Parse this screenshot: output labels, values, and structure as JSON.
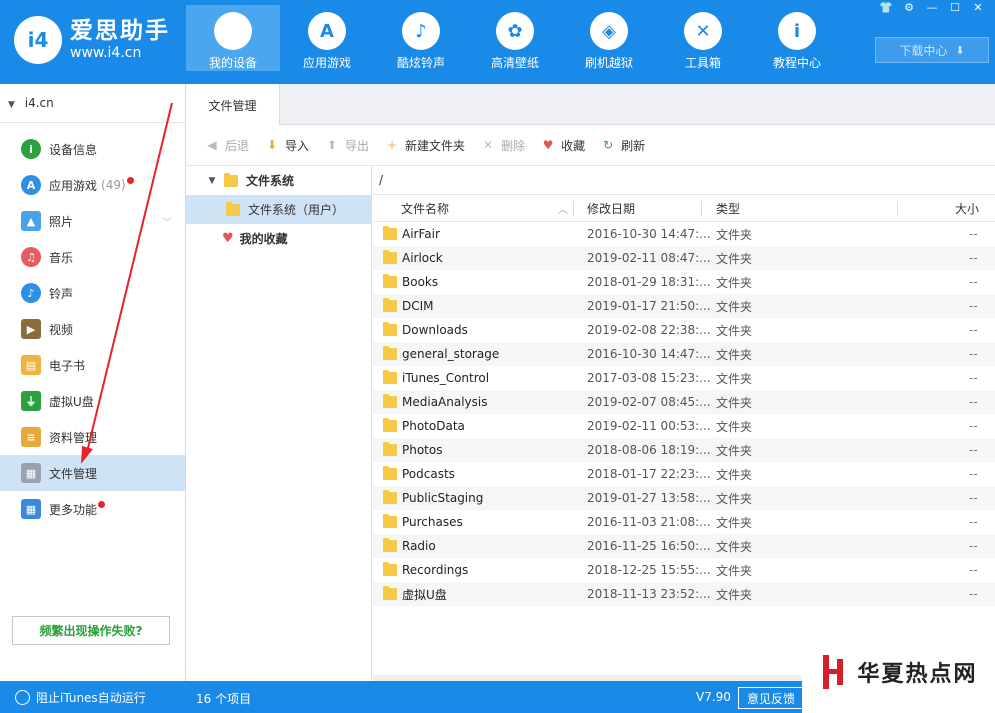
{
  "brand": {
    "badge": "i4",
    "name": "爱思助手",
    "url": "www.i4.cn"
  },
  "nav": [
    {
      "label": "我的设备",
      "icon": "apple-icon",
      "glyph": "",
      "active": true
    },
    {
      "label": "应用游戏",
      "icon": "app-store-icon",
      "glyph": "A"
    },
    {
      "label": "酷炫铃声",
      "icon": "bell-icon",
      "glyph": "♪"
    },
    {
      "label": "高清壁纸",
      "icon": "flower-icon",
      "glyph": "✿"
    },
    {
      "label": "刷机越狱",
      "icon": "dropbox-icon",
      "glyph": "◈"
    },
    {
      "label": "工具箱",
      "icon": "tools-icon",
      "glyph": "✕"
    },
    {
      "label": "教程中心",
      "icon": "info-icon",
      "glyph": "i"
    }
  ],
  "window_buttons": [
    "👕",
    "⚙",
    "—",
    "☐",
    "✕"
  ],
  "download_center": "下载中心",
  "sidebar": {
    "device": "i4.cn",
    "items": [
      {
        "label": "设备信息",
        "icon": "info-circle-icon",
        "glyph": "i",
        "color": "#2aa13b"
      },
      {
        "label": "应用游戏",
        "count": "(49)",
        "dot": true,
        "icon": "app-store-icon",
        "glyph": "A",
        "color": "#2f8ee5"
      },
      {
        "label": "照片",
        "chevron": true,
        "icon": "photo-icon",
        "glyph": "▲",
        "color": "#4aa3e8",
        "square": true
      },
      {
        "label": "音乐",
        "icon": "music-icon",
        "glyph": "♫",
        "color": "#e65d5d"
      },
      {
        "label": "铃声",
        "icon": "bell-icon",
        "glyph": "♪",
        "color": "#2f8ee5"
      },
      {
        "label": "视频",
        "icon": "video-icon",
        "glyph": "▶",
        "color": "#8a6d3b",
        "square": true
      },
      {
        "label": "电子书",
        "icon": "book-icon",
        "glyph": "▤",
        "color": "#f0b43c",
        "square": true
      },
      {
        "label": "虚拟U盘",
        "icon": "usb-icon",
        "glyph": "⏚",
        "color": "#2aa13b",
        "square": true
      },
      {
        "label": "资料管理",
        "icon": "document-icon",
        "glyph": "≡",
        "color": "#e8a93c",
        "square": true
      },
      {
        "label": "文件管理",
        "icon": "files-icon",
        "glyph": "▦",
        "color": "#9aa3ad",
        "square": true,
        "active": true
      },
      {
        "label": "更多功能",
        "dot": true,
        "icon": "grid-icon",
        "glyph": "▦",
        "color": "#3b8ad9",
        "square": true
      }
    ],
    "help": "频繁出现操作失败?"
  },
  "tab": "文件管理",
  "toolbar": [
    {
      "label": "后退",
      "icon": "back-icon",
      "glyph": "◀",
      "color": "#bbb",
      "disabled": true
    },
    {
      "label": "导入",
      "icon": "import-icon",
      "glyph": "⬇",
      "color": "#e8a93c"
    },
    {
      "label": "导出",
      "icon": "export-icon",
      "glyph": "⬆",
      "color": "#bbb",
      "disabled": true
    },
    {
      "label": "新建文件夹",
      "icon": "new-folder-icon",
      "glyph": "+",
      "color": "#f0b43c"
    },
    {
      "label": "删除",
      "icon": "delete-icon",
      "glyph": "✕",
      "color": "#bbb",
      "disabled": true
    },
    {
      "label": "收藏",
      "icon": "heart-icon",
      "glyph": "♥",
      "color": "#e35454"
    },
    {
      "label": "刷新",
      "icon": "refresh-icon",
      "glyph": "↻",
      "color": "#2aa13b"
    }
  ],
  "tree": {
    "root": "文件系统",
    "child": "文件系统（用户）",
    "favorites": "我的收藏"
  },
  "path": "/",
  "columns": {
    "name": "文件名称",
    "date": "修改日期",
    "type": "类型",
    "size": "大小"
  },
  "files": [
    {
      "name": "AirFair",
      "date": "2016-10-30 14:47:...",
      "type": "文件夹",
      "size": "--"
    },
    {
      "name": "Airlock",
      "date": "2019-02-11 08:47:...",
      "type": "文件夹",
      "size": "--"
    },
    {
      "name": "Books",
      "date": "2018-01-29 18:31:...",
      "type": "文件夹",
      "size": "--"
    },
    {
      "name": "DCIM",
      "date": "2019-01-17 21:50:...",
      "type": "文件夹",
      "size": "--"
    },
    {
      "name": "Downloads",
      "date": "2019-02-08 22:38:...",
      "type": "文件夹",
      "size": "--"
    },
    {
      "name": "general_storage",
      "date": "2016-10-30 14:47:...",
      "type": "文件夹",
      "size": "--"
    },
    {
      "name": "iTunes_Control",
      "date": "2017-03-08 15:23:...",
      "type": "文件夹",
      "size": "--"
    },
    {
      "name": "MediaAnalysis",
      "date": "2019-02-07 08:45:...",
      "type": "文件夹",
      "size": "--"
    },
    {
      "name": "PhotoData",
      "date": "2019-02-11 00:53:...",
      "type": "文件夹",
      "size": "--"
    },
    {
      "name": "Photos",
      "date": "2018-08-06 18:19:...",
      "type": "文件夹",
      "size": "--"
    },
    {
      "name": "Podcasts",
      "date": "2018-01-17 22:23:...",
      "type": "文件夹",
      "size": "--"
    },
    {
      "name": "PublicStaging",
      "date": "2019-01-27 13:58:...",
      "type": "文件夹",
      "size": "--"
    },
    {
      "name": "Purchases",
      "date": "2016-11-03 21:08:...",
      "type": "文件夹",
      "size": "--"
    },
    {
      "name": "Radio",
      "date": "2016-11-25 16:50:...",
      "type": "文件夹",
      "size": "--"
    },
    {
      "name": "Recordings",
      "date": "2018-12-25 15:55:...",
      "type": "文件夹",
      "size": "--"
    },
    {
      "name": "虚拟U盘",
      "date": "2018-11-13 23:52:...",
      "type": "文件夹",
      "size": "--"
    }
  ],
  "status": {
    "itunes": "阻止iTunes自动运行",
    "count": "16 个项目",
    "version": "V7.90",
    "feedback": "意见反馈"
  },
  "watermark": "华夏热点网",
  "colors": {
    "accent": "#1a8ae8",
    "selected": "#cfe3f7",
    "annotation": "#e8222b"
  }
}
